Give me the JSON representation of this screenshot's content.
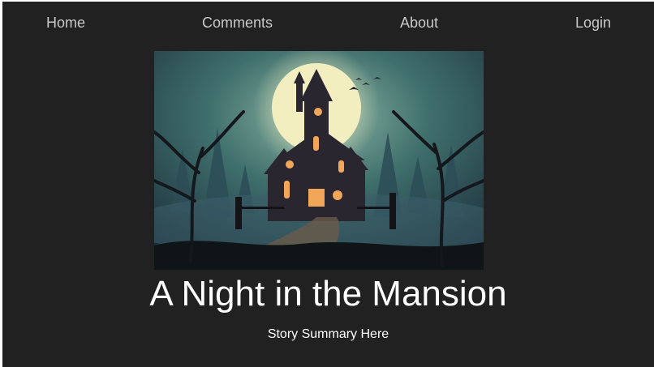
{
  "nav": {
    "items": [
      {
        "label": "Home"
      },
      {
        "label": "Comments"
      },
      {
        "label": "About"
      },
      {
        "label": "Login"
      }
    ]
  },
  "hero": {
    "image": "haunted-mansion-illustration"
  },
  "story": {
    "title": "A Night in the Mansion",
    "summary": "Story Summary Here"
  },
  "colors": {
    "background": "#212121",
    "nav_text": "#c9c9c9",
    "heading_text": "#ffffff",
    "moon": "#f3eec0"
  }
}
